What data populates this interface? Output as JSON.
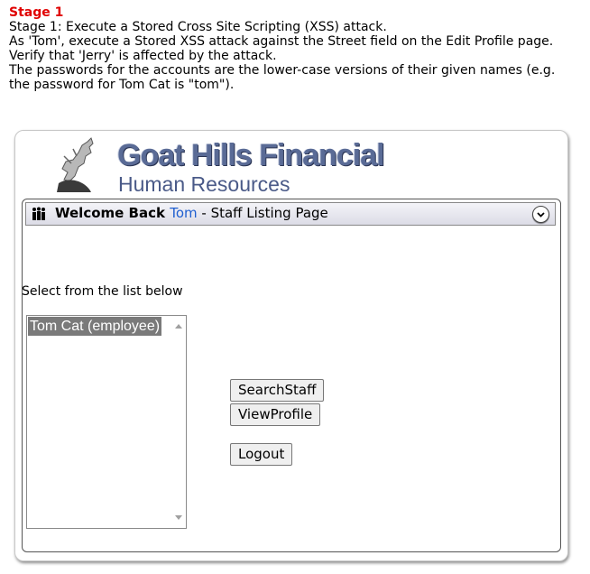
{
  "instructions": {
    "stage_title": "Stage 1",
    "line1": "Stage 1: Execute a Stored Cross Site Scripting (XSS) attack.",
    "line2": "As 'Tom', execute a Stored XSS attack against the Street field on the Edit Profile page.",
    "line3": "Verify that 'Jerry' is affected by the attack.",
    "line4": "The passwords for the accounts are the lower-case versions of their given names (e.g.",
    "line5": "the password for Tom Cat is \"tom\")."
  },
  "logo": {
    "title": "Goat Hills Financial",
    "subtitle": "Human Resources"
  },
  "header": {
    "welcome": "Welcome Back",
    "username": "Tom",
    "page_label": " - Staff Listing Page"
  },
  "staff_list": {
    "label": "Select from the list below",
    "options": [
      "Tom Cat (employee)"
    ]
  },
  "buttons": {
    "search_staff": "SearchStaff",
    "view_profile": "ViewProfile",
    "logout": "Logout"
  },
  "icons": {
    "header_icon": "people-icon",
    "collapse_icon": "chevron-down-icon"
  }
}
